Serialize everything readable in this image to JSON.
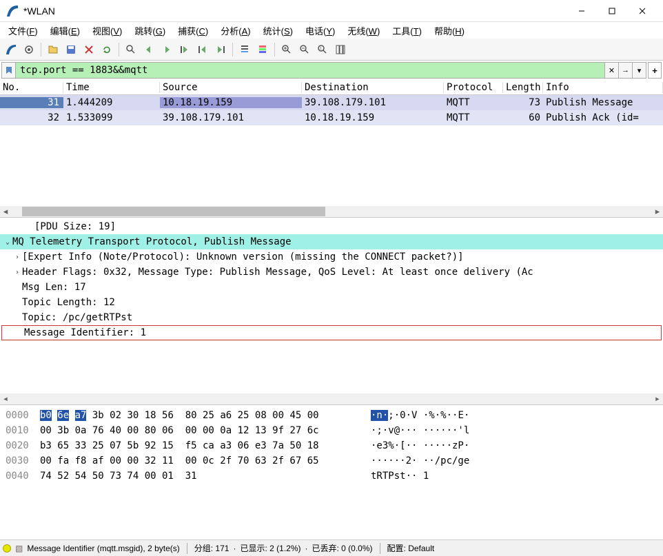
{
  "window": {
    "title": "*WLAN"
  },
  "menu": {
    "items": [
      {
        "label": "文件(",
        "u": "F",
        "after": ")"
      },
      {
        "label": "编辑(",
        "u": "E",
        "after": ")"
      },
      {
        "label": "视图(",
        "u": "V",
        "after": ")"
      },
      {
        "label": "跳转(",
        "u": "G",
        "after": ")"
      },
      {
        "label": "捕获(",
        "u": "C",
        "after": ")"
      },
      {
        "label": "分析(",
        "u": "A",
        "after": ")"
      },
      {
        "label": "统计(",
        "u": "S",
        "after": ")"
      },
      {
        "label": "电话(",
        "u": "Y",
        "after": ")"
      },
      {
        "label": "无线(",
        "u": "W",
        "after": ")"
      },
      {
        "label": "工具(",
        "u": "T",
        "after": ")"
      },
      {
        "label": "帮助(",
        "u": "H",
        "after": ")"
      }
    ]
  },
  "filter": {
    "value": "tcp.port == 1883&&mqtt"
  },
  "packet_list": {
    "columns": [
      "No.",
      "Time",
      "Source",
      "Destination",
      "Protocol",
      "Length",
      "Info"
    ],
    "rows": [
      {
        "no": "31",
        "time": "1.444209",
        "src": "10.18.19.159",
        "dst": "39.108.179.101",
        "proto": "MQTT",
        "len": "73",
        "info": "Publish Message",
        "selected": true,
        "bg": "#d6d9f0"
      },
      {
        "no": "32",
        "time": "1.533099",
        "src": "39.108.179.101",
        "dst": "10.18.19.159",
        "proto": "MQTT",
        "len": "60",
        "info": "Publish Ack (id=",
        "selected": false,
        "bg": "#e0e4f5"
      }
    ]
  },
  "packet_details": {
    "lines": [
      {
        "indent": 2,
        "text": "[PDU Size: 19]",
        "exp": ""
      },
      {
        "indent": 0,
        "text": "MQ Telemetry Transport Protocol, Publish Message",
        "exp": "v",
        "hilite": true
      },
      {
        "indent": 1,
        "text": "[Expert Info (Note/Protocol): Unknown version (missing the CONNECT packet?)]",
        "exp": ">"
      },
      {
        "indent": 1,
        "text": "Header Flags: 0x32, Message Type: Publish Message, QoS Level: At least once delivery (Ac",
        "exp": ">"
      },
      {
        "indent": 1,
        "text": "Msg Len: 17",
        "exp": ""
      },
      {
        "indent": 1,
        "text": "Topic Length: 12",
        "exp": ""
      },
      {
        "indent": 1,
        "text": "Topic: /pc/getRTPst",
        "exp": ""
      },
      {
        "indent": 1,
        "text": "Message Identifier: 1",
        "exp": "",
        "boxed": true
      }
    ]
  },
  "hex": {
    "rows": [
      {
        "off": "0000",
        "b": "b0 6e a7 3b 02 30 18 56  80 25 a6 25 08 00 45 00",
        "a": "·n·;·0·V ·%·%··E·",
        "sel": [
          0,
          1,
          2
        ]
      },
      {
        "off": "0010",
        "b": "00 3b 0a 76 40 00 80 06  00 00 0a 12 13 9f 27 6c",
        "a": "·;·v@··· ······'l"
      },
      {
        "off": "0020",
        "b": "b3 65 33 25 07 5b 92 15  f5 ca a3 06 e3 7a 50 18",
        "a": "·e3%·[·· ·····zP·"
      },
      {
        "off": "0030",
        "b": "00 fa f8 af 00 00 32 11  00 0c 2f 70 63 2f 67 65",
        "a": "······2· ··/pc/ge"
      },
      {
        "off": "0040",
        "b": "74 52 54 50 73 74 00 01  31",
        "a": "tRTPst·· 1"
      }
    ]
  },
  "status": {
    "field": "Message Identifier (mqtt.msgid), 2 byte(s)",
    "packets": "分组: 171",
    "displayed": "已显示: 2 (1.2%)",
    "dropped": "已丢弃: 0 (0.0%)",
    "profile": "配置: Default"
  }
}
